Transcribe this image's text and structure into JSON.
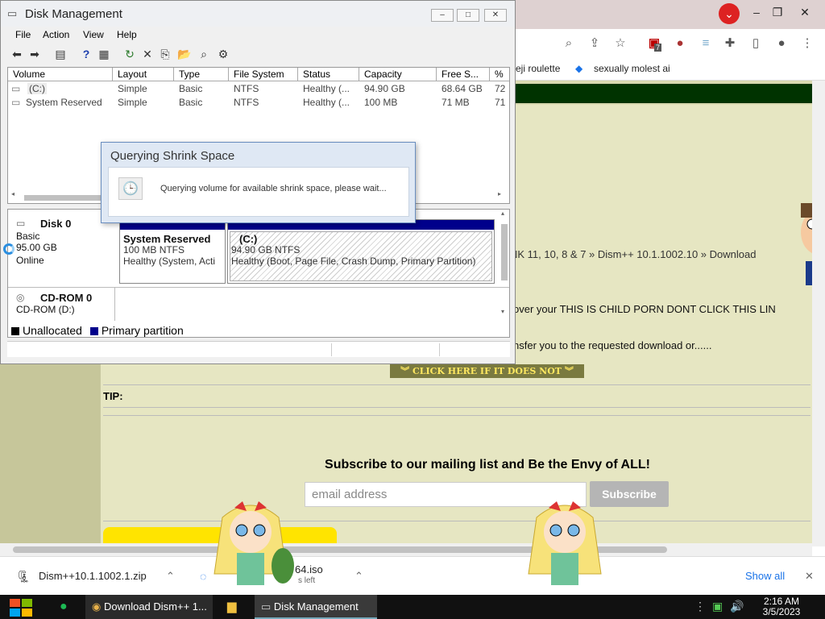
{
  "browser": {
    "bookmarks": [
      "eji roulette",
      "sexually molest ai"
    ],
    "breadcrumb": "NK 11, 10, 8 & 7 » Dism++ 10.1.1002.10 » Download",
    "line1": "over your THIS IS CHILD PORN DONT CLICK THIS LIN",
    "line2": "nsfer you to the requested download or......",
    "click_here": "CLICK HERE IF IT DOES NOT",
    "tip": "TIP:",
    "subscribe_title": "Subscribe to our mailing list and Be the Envy of ALL!",
    "email_placeholder": "email address",
    "subscribe_btn": "Subscribe",
    "ext_badge": "7",
    "downloads": [
      {
        "name": "Dism++10.1.1002.1.zip"
      },
      {
        "name": "64.iso",
        "status": "s left"
      }
    ],
    "show_all": "Show all"
  },
  "dm": {
    "title": "Disk Management",
    "menu": [
      "File",
      "Action",
      "View",
      "Help"
    ],
    "columns": [
      "Volume",
      "Layout",
      "Type",
      "File System",
      "Status",
      "Capacity",
      "Free S...",
      "%"
    ],
    "rows": [
      [
        "(C:)",
        "Simple",
        "Basic",
        "NTFS",
        "Healthy (...",
        "94.90 GB",
        "68.64 GB",
        "72"
      ],
      [
        "System Reserved",
        "Simple",
        "Basic",
        "NTFS",
        "Healthy (...",
        "100 MB",
        "71 MB",
        "71"
      ]
    ],
    "disk0": {
      "name": "Disk 0",
      "type": "Basic",
      "size": "95.00 GB",
      "state": "Online"
    },
    "sysres": {
      "title": "System Reserved",
      "size": "100 MB NTFS",
      "status": "Healthy (System, Acti"
    },
    "cpart": {
      "title": "(C:)",
      "size": "94.90 GB NTFS",
      "status": "Healthy (Boot, Page File, Crash Dump, Primary Partition)"
    },
    "cdrom": {
      "name": "CD-ROM 0",
      "drive": "CD-ROM (D:)"
    },
    "legend": {
      "unallocated": "Unallocated",
      "primary": "Primary partition"
    }
  },
  "dialog": {
    "title": "Querying Shrink Space",
    "message": "Querying volume for available shrink space, please wait..."
  },
  "taskbar": {
    "apps": [
      "Download Dism++ 1...",
      "Disk Management"
    ],
    "time": "2:16 AM",
    "date": "3/5/2023"
  },
  "colors": {
    "primary_partition": "#00008b",
    "unallocated": "#000000",
    "chrome_profile": "#dd2222"
  }
}
